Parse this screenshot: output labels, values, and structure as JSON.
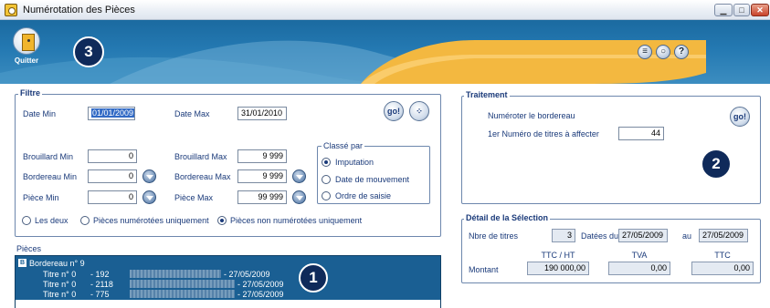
{
  "window": {
    "title": "Numérotation des Pièces"
  },
  "header": {
    "quit_label": "Quitter",
    "badge_3": "3"
  },
  "filtre": {
    "title": "Filtre",
    "date_min_label": "Date Min",
    "date_min": "01/01/2009",
    "date_max_label": "Date Max",
    "date_max": "31/01/2010",
    "go_label": "go!",
    "brouillard_min_label": "Brouillard Min",
    "brouillard_min": "0",
    "brouillard_max_label": "Brouillard Max",
    "brouillard_max": "9 999",
    "bordereau_min_label": "Bordereau Min",
    "bordereau_min": "0",
    "bordereau_max_label": "Bordereau Max",
    "bordereau_max": "9 999",
    "piece_min_label": "Pièce Min",
    "piece_min": "0",
    "piece_max_label": "Pièce Max",
    "piece_max": "99 999",
    "classe_title": "Classé par",
    "classe_options": [
      "Imputation",
      "Date de mouvement",
      "Ordre de saisie"
    ],
    "classe_selected": "Imputation",
    "scope_options": [
      "Les deux",
      "Pièces numérotées uniquement",
      "Pièces non numérotées uniquement"
    ],
    "scope_selected": "Pièces non numérotées uniquement"
  },
  "traitement": {
    "title": "Traitement",
    "numeroter_label": "Numéroter le bordereau",
    "first_num_label": "1er Numéro de titres à affecter",
    "first_num": "44",
    "go_label": "go!",
    "badge_2": "2"
  },
  "detail": {
    "title": "Détail de la Sélection",
    "nbre_label": "Nbre de titres",
    "nbre": "3",
    "datees_label": "Datées du",
    "date_from": "27/05/2009",
    "au_label": "au",
    "date_to": "27/05/2009",
    "col_ttc_ht": "TTC / HT",
    "col_tva": "TVA",
    "col_ttc": "TTC",
    "montant_label": "Montant",
    "montant_ttc_ht": "190 000,00",
    "montant_tva": "0,00",
    "montant_ttc": "0,00"
  },
  "pieces": {
    "title": "Pièces",
    "badge_1": "1",
    "bordereau": "Bordereau n° 9",
    "rows": [
      {
        "titre": "Titre n° 0",
        "num": "- 192",
        "date": "- 27/05/2009"
      },
      {
        "titre": "Titre n° 0",
        "num": "- 2118",
        "date": "- 27/05/2009"
      },
      {
        "titre": "Titre n° 0",
        "num": "- 775",
        "date": "- 27/05/2009"
      }
    ]
  },
  "colors": {
    "header_blue": "#1b6aa0",
    "accent_yellow": "#f3b840",
    "text_navy": "#1a3a7a",
    "list_bg": "#1a5f93"
  }
}
